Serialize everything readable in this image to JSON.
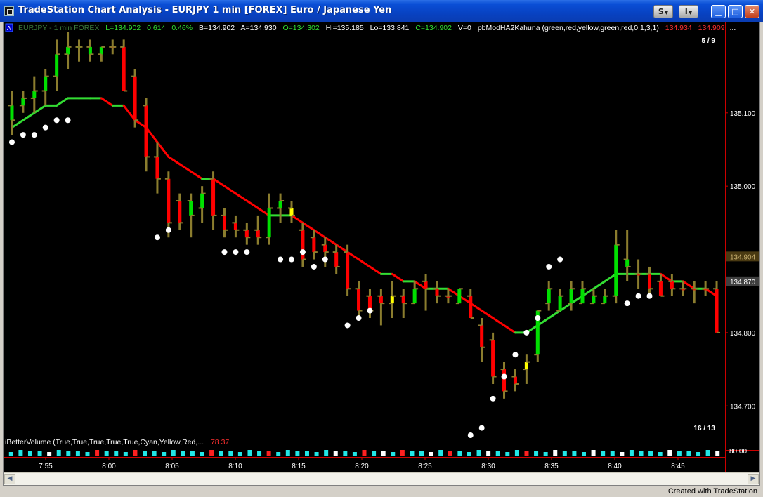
{
  "window": {
    "title": "TradeStation Chart Analysis - EURJPY  1 min  [FOREX] Euro / Japanese Yen",
    "buttons": {
      "s_label": "S",
      "i_label": "I"
    }
  },
  "status_line": {
    "symbol_desc": "EURJPY - 1 min  FOREX",
    "last": "L=134.902",
    "net_change": "0.614",
    "pct_change": "0.46%",
    "bid": "B=134.902",
    "ask": "A=134.930",
    "open": "O=134.302",
    "high": "Hi=135.185",
    "low": "Lo=133.841",
    "close": "C=134.902",
    "volume": "V=0",
    "indicator": "pbModHA2Kahuna (green,red,yellow,green,red,0,1,3,1)",
    "ind_val1": "134.934",
    "ind_val2": "134.909",
    "ellipsis": "...",
    "counter_top": "5 / 9"
  },
  "price_axis": {
    "ticks": [
      "135.100",
      "135.000",
      "134.800",
      "134.700"
    ],
    "tick_values": [
      135.1,
      135.0,
      134.8,
      134.7
    ],
    "markers": [
      {
        "label": "134.904",
        "value": 134.904,
        "bg": "#4a3a12",
        "color": "#c8b070"
      },
      {
        "label": "134.870",
        "value": 134.87,
        "bg": "#404040",
        "color": "#ffffff"
      }
    ]
  },
  "volume_panel": {
    "label": "iBetterVolume (True,True,True,True,True,Cyan,Yellow,Red,...",
    "value": "78.37",
    "axis_label": "80.00",
    "counter": "16 / 13"
  },
  "time_axis": [
    "7:55",
    "8:00",
    "8:05",
    "8:10",
    "8:15",
    "8:20",
    "8:25",
    "8:30",
    "8:35",
    "8:40",
    "8:45"
  ],
  "footer": {
    "credit": "Created with TradeStation"
  },
  "colors": {
    "background": "#000000",
    "up_bar": "#00e000",
    "down_bar": "#ff0000",
    "neutral_bar": "#ffff00",
    "wick": "#8b7d2e",
    "ma_up": "#33dd33",
    "ma_down": "#ff0000",
    "dots": "#ffffff",
    "volume_cyan": "#22e6e6",
    "volume_red": "#ff2020",
    "volume_white": "#ffffff"
  },
  "chart_data": {
    "type": "candlestick",
    "symbol": "EURJPY",
    "interval": "1 min",
    "y_range": [
      134.66,
      135.21
    ],
    "x_labels": [
      "7:55",
      "8:00",
      "8:05",
      "8:10",
      "8:15",
      "8:20",
      "8:25",
      "8:30",
      "8:35",
      "8:40",
      "8:45"
    ],
    "bars": [
      [
        135.11,
        135.13,
        135.07,
        135.09,
        "g"
      ],
      [
        135.11,
        135.13,
        135.1,
        135.12,
        "g"
      ],
      [
        135.12,
        135.15,
        135.1,
        135.13,
        "g"
      ],
      [
        135.13,
        135.16,
        135.11,
        135.15,
        "g"
      ],
      [
        135.15,
        135.2,
        135.13,
        135.18,
        "g"
      ],
      [
        135.18,
        135.21,
        135.16,
        135.19,
        "g"
      ],
      [
        135.19,
        135.2,
        135.17,
        135.19,
        "g"
      ],
      [
        135.19,
        135.2,
        135.17,
        135.18,
        "g"
      ],
      [
        135.18,
        135.19,
        135.17,
        135.19,
        "g"
      ],
      [
        135.19,
        135.2,
        135.18,
        135.19,
        "r"
      ],
      [
        135.19,
        135.2,
        135.13,
        135.13,
        "r"
      ],
      [
        135.15,
        135.16,
        135.08,
        135.09,
        "r"
      ],
      [
        135.11,
        135.12,
        135.02,
        135.04,
        "r"
      ],
      [
        135.04,
        135.06,
        134.99,
        135.01,
        "r"
      ],
      [
        135.01,
        135.02,
        134.93,
        134.95,
        "r"
      ],
      [
        134.98,
        134.99,
        134.94,
        134.95,
        "r"
      ],
      [
        134.98,
        134.99,
        134.93,
        134.96,
        "g"
      ],
      [
        134.97,
        135.0,
        134.95,
        134.99,
        "g"
      ],
      [
        135.01,
        135.02,
        134.94,
        134.96,
        "r"
      ],
      [
        134.96,
        134.97,
        134.93,
        134.94,
        "r"
      ],
      [
        134.95,
        134.96,
        134.93,
        134.94,
        "r"
      ],
      [
        134.94,
        134.95,
        134.92,
        134.93,
        "r"
      ],
      [
        134.94,
        134.96,
        134.92,
        134.93,
        "r"
      ],
      [
        134.93,
        134.99,
        134.92,
        134.97,
        "g"
      ],
      [
        134.97,
        134.99,
        134.95,
        134.98,
        "g"
      ],
      [
        134.97,
        134.98,
        134.95,
        134.96,
        "y"
      ],
      [
        134.94,
        134.95,
        134.89,
        134.9,
        "r"
      ],
      [
        134.93,
        134.94,
        134.9,
        134.91,
        "r"
      ],
      [
        134.92,
        134.93,
        134.89,
        134.91,
        "r"
      ],
      [
        134.91,
        134.92,
        134.88,
        134.89,
        "r"
      ],
      [
        134.91,
        134.92,
        134.85,
        134.86,
        "r"
      ],
      [
        134.86,
        134.87,
        134.82,
        134.83,
        "r"
      ],
      [
        134.85,
        134.86,
        134.82,
        134.83,
        "r"
      ],
      [
        134.85,
        134.86,
        134.81,
        134.84,
        "r"
      ],
      [
        134.84,
        134.87,
        134.82,
        134.85,
        "y"
      ],
      [
        134.85,
        134.86,
        134.82,
        134.84,
        "r"
      ],
      [
        134.84,
        134.87,
        134.84,
        134.86,
        "g"
      ],
      [
        134.87,
        134.88,
        134.83,
        134.86,
        "r"
      ],
      [
        134.86,
        134.87,
        134.84,
        134.85,
        "r"
      ],
      [
        134.85,
        134.86,
        134.84,
        134.85,
        "r"
      ],
      [
        134.84,
        134.86,
        134.84,
        134.86,
        "g"
      ],
      [
        134.85,
        134.86,
        134.82,
        134.82,
        "r"
      ],
      [
        134.81,
        134.82,
        134.76,
        134.78,
        "r"
      ],
      [
        134.79,
        134.8,
        134.73,
        134.74,
        "r"
      ],
      [
        134.75,
        134.76,
        134.71,
        134.72,
        "r"
      ],
      [
        134.74,
        134.75,
        134.72,
        134.73,
        "r"
      ],
      [
        134.75,
        134.77,
        134.73,
        134.76,
        "y"
      ],
      [
        134.77,
        134.83,
        134.76,
        134.83,
        "g"
      ],
      [
        134.84,
        134.87,
        134.83,
        134.86,
        "g"
      ],
      [
        134.83,
        134.86,
        134.83,
        134.85,
        "g"
      ],
      [
        134.84,
        134.87,
        134.83,
        134.86,
        "g"
      ],
      [
        134.84,
        134.87,
        134.84,
        134.86,
        "g"
      ],
      [
        134.84,
        134.86,
        134.84,
        134.85,
        "g"
      ],
      [
        134.84,
        134.86,
        134.84,
        134.85,
        "g"
      ],
      [
        134.85,
        134.94,
        134.84,
        134.92,
        "g"
      ],
      [
        134.9,
        134.94,
        134.87,
        134.89,
        "g"
      ],
      [
        134.88,
        134.9,
        134.86,
        134.88,
        "r"
      ],
      [
        134.88,
        134.89,
        134.85,
        134.86,
        "r"
      ],
      [
        134.87,
        134.88,
        134.85,
        134.85,
        "r"
      ],
      [
        134.87,
        134.88,
        134.85,
        134.86,
        "r"
      ],
      [
        134.86,
        134.87,
        134.85,
        134.86,
        "r"
      ],
      [
        134.86,
        134.87,
        134.84,
        134.86,
        "r"
      ],
      [
        134.86,
        134.87,
        134.85,
        134.86,
        "r"
      ],
      [
        134.86,
        134.87,
        134.81,
        134.8,
        "r"
      ]
    ],
    "moving_average": [
      135.08,
      135.09,
      135.1,
      135.11,
      135.11,
      135.12,
      135.12,
      135.12,
      135.12,
      135.11,
      135.11,
      135.09,
      135.08,
      135.06,
      135.04,
      135.03,
      135.02,
      135.01,
      135.01,
      135.0,
      134.99,
      134.98,
      134.97,
      134.96,
      134.96,
      134.96,
      134.95,
      134.94,
      134.93,
      134.92,
      134.91,
      134.9,
      134.89,
      134.88,
      134.88,
      134.87,
      134.87,
      134.86,
      134.86,
      134.86,
      134.85,
      134.84,
      134.83,
      134.82,
      134.81,
      134.8,
      134.8,
      134.81,
      134.82,
      134.83,
      134.84,
      134.85,
      134.86,
      134.87,
      134.88,
      134.88,
      134.88,
      134.88,
      134.88,
      134.87,
      134.87,
      134.86,
      134.86,
      134.85
    ],
    "dots": [
      [
        0,
        135.06
      ],
      [
        1,
        135.07
      ],
      [
        2,
        135.07
      ],
      [
        3,
        135.08
      ],
      [
        4,
        135.09
      ],
      [
        5,
        135.09
      ],
      [
        13,
        134.93
      ],
      [
        14,
        134.94
      ],
      [
        19,
        134.91
      ],
      [
        20,
        134.91
      ],
      [
        21,
        134.91
      ],
      [
        24,
        134.9
      ],
      [
        25,
        134.9
      ],
      [
        26,
        134.91
      ],
      [
        27,
        134.89
      ],
      [
        28,
        134.9
      ],
      [
        30,
        134.81
      ],
      [
        31,
        134.82
      ],
      [
        32,
        134.83
      ],
      [
        41,
        134.66
      ],
      [
        42,
        134.67
      ],
      [
        43,
        134.71
      ],
      [
        44,
        134.74
      ],
      [
        45,
        134.77
      ],
      [
        46,
        134.8
      ],
      [
        47,
        134.82
      ],
      [
        48,
        134.89
      ],
      [
        49,
        134.9
      ],
      [
        55,
        134.84
      ],
      [
        56,
        134.85
      ],
      [
        57,
        134.85
      ]
    ],
    "volume": [
      "c",
      "c",
      "c",
      "c",
      "w",
      "c",
      "c",
      "c",
      "c",
      "r",
      "c",
      "c",
      "c",
      "r",
      "c",
      "c",
      "c",
      "c",
      "c",
      "c",
      "c",
      "r",
      "c",
      "c",
      "c",
      "c",
      "c",
      "r",
      "c",
      "c",
      "c",
      "c",
      "c",
      "c",
      "w",
      "c",
      "c",
      "r",
      "c",
      "w",
      "c",
      "r",
      "c",
      "c",
      "w",
      "c",
      "r",
      "c",
      "c",
      "c",
      "w",
      "c",
      "c",
      "c",
      "r",
      "c",
      "c",
      "w",
      "c",
      "c",
      "c",
      "w",
      "c",
      "c",
      "w",
      "c",
      "c",
      "c",
      "c",
      "w",
      "c",
      "c",
      "c",
      "c",
      "w"
    ]
  }
}
